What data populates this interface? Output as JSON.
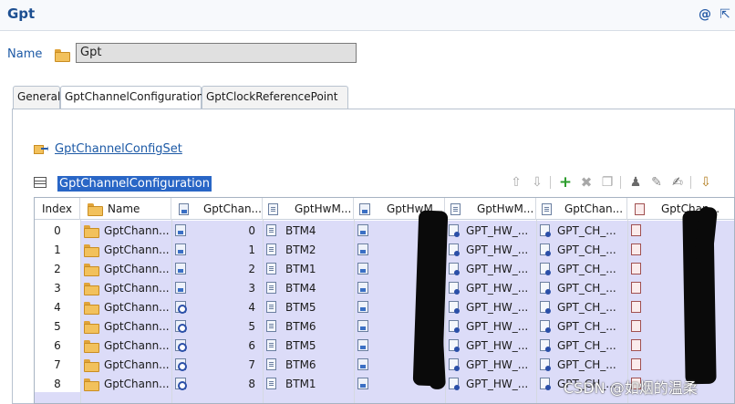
{
  "header": {
    "title": "Gpt",
    "help_icon": "@",
    "open_icon": "⇱"
  },
  "name_field": {
    "label": "Name",
    "value": "Gpt"
  },
  "tabs": [
    {
      "label": "General",
      "active": false
    },
    {
      "label": "GptChannelConfiguration",
      "active": true
    },
    {
      "label": "GptClockReferencePoint",
      "active": false
    }
  ],
  "config_set_link": "GptChannelConfigSet",
  "table_title": "GptChannelConfiguration",
  "toolbar": {
    "icons": [
      "arrow-up-icon",
      "arrow-down-icon",
      "add-icon",
      "delete-icon",
      "copy-icon",
      "user-icon",
      "edit-icon",
      "notes-icon",
      "export-icon"
    ]
  },
  "columns": [
    {
      "label": "Index",
      "icon": ""
    },
    {
      "label": "Name",
      "icon": "folder-icon"
    },
    {
      "label": "GptChan...",
      "icon": "number-icon"
    },
    {
      "label": "GptHwM...",
      "icon": "doc-icon"
    },
    {
      "label": "GptHwM...",
      "icon": "number-icon"
    },
    {
      "label": "GptHwM...",
      "icon": "doc-icon"
    },
    {
      "label": "GptChan...",
      "icon": "doc-icon"
    },
    {
      "label": "GptChan...",
      "icon": "red-doc-icon"
    }
  ],
  "rows": [
    {
      "index": "0",
      "name": "GptChann...",
      "chan_id": "0",
      "hw_module": "BTM4",
      "hw_ref": "GPT_HW_...",
      "chan_ref": "GPT_CH_..."
    },
    {
      "index": "1",
      "name": "GptChann...",
      "chan_id": "1",
      "hw_module": "BTM2",
      "hw_ref": "GPT_HW_...",
      "chan_ref": "GPT_CH_..."
    },
    {
      "index": "2",
      "name": "GptChann...",
      "chan_id": "2",
      "hw_module": "BTM1",
      "hw_ref": "GPT_HW_...",
      "chan_ref": "GPT_CH_..."
    },
    {
      "index": "3",
      "name": "GptChann...",
      "chan_id": "3",
      "hw_module": "BTM4",
      "hw_ref": "GPT_HW_...",
      "chan_ref": "GPT_CH_..."
    },
    {
      "index": "4",
      "name": "GptChann...",
      "chan_id": "4",
      "hw_module": "BTM5",
      "hw_ref": "GPT_HW_...",
      "chan_ref": "GPT_CH_..."
    },
    {
      "index": "5",
      "name": "GptChann...",
      "chan_id": "5",
      "hw_module": "BTM6",
      "hw_ref": "GPT_HW_...",
      "chan_ref": "GPT_CH_..."
    },
    {
      "index": "6",
      "name": "GptChann...",
      "chan_id": "6",
      "hw_module": "BTM5",
      "hw_ref": "GPT_HW_...",
      "chan_ref": "GPT_CH_..."
    },
    {
      "index": "7",
      "name": "GptChann...",
      "chan_id": "7",
      "hw_module": "BTM6",
      "hw_ref": "GPT_HW_...",
      "chan_ref": "GPT_CH_..."
    },
    {
      "index": "8",
      "name": "GptChann...",
      "chan_id": "8",
      "hw_module": "BTM1",
      "hw_ref": "GPT_HW_...",
      "chan_ref": "GPT_CH_..."
    }
  ],
  "watermark": "CSDN @如烟的温柔",
  "colors": {
    "accent": "#1d5aa6",
    "selection": "#2966c6",
    "row_highlight": "#dcdcf8"
  }
}
